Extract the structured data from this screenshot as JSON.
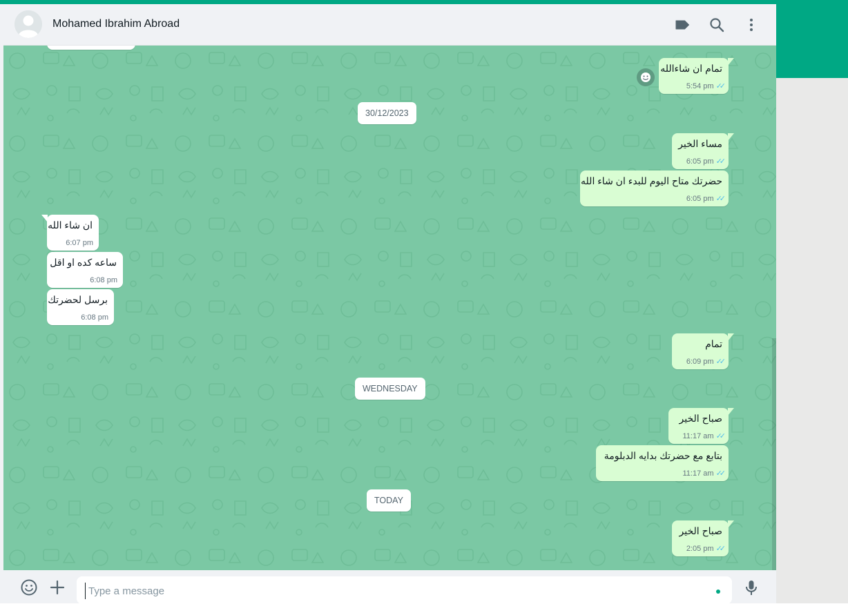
{
  "colors": {
    "accent": "#00a884",
    "chat_background": "#7bc8a4",
    "outgoing_bubble": "#d9fdd3",
    "incoming_bubble": "#ffffff",
    "read_ticks": "#53bdeb"
  },
  "header": {
    "contact_name": "Mohamed Ibrahim Abroad",
    "icons": [
      "label-icon",
      "search-icon",
      "menu-icon"
    ]
  },
  "chat": {
    "messages": [
      {
        "direction": "out",
        "text": "تمام ان شاءالله",
        "time": "5:54 pm",
        "read": true
      },
      {
        "date_separator": "30/12/2023"
      },
      {
        "direction": "out",
        "text": "مساء الخير",
        "time": "6:05 pm",
        "read": true
      },
      {
        "direction": "out",
        "text": "حضرتك متاح اليوم للبدء ان شاء الله",
        "time": "6:05 pm",
        "read": true
      },
      {
        "direction": "in",
        "text": "ان شاء الله",
        "time": "6:07 pm"
      },
      {
        "direction": "in",
        "text": "ساعه كده او اقل",
        "time": "6:08 pm"
      },
      {
        "direction": "in",
        "text": "برسل لحضرتك",
        "time": "6:08 pm"
      },
      {
        "direction": "out",
        "text": "تمام",
        "time": "6:09 pm",
        "read": true
      },
      {
        "date_separator": "WEDNESDAY"
      },
      {
        "direction": "out",
        "text": "صباح الخير",
        "time": "11:17 am",
        "read": true
      },
      {
        "direction": "out",
        "text": "بتابع مع حضرتك بدايه الدبلومة",
        "time": "11:17 am",
        "read": true
      },
      {
        "date_separator": "TODAY"
      },
      {
        "direction": "out",
        "text": "صباح الخير",
        "time": "2:05 pm",
        "read": true
      }
    ]
  },
  "footer": {
    "placeholder": "Type a message",
    "icons": [
      "emoji-icon",
      "attach-plus-icon",
      "microphone-icon"
    ]
  }
}
